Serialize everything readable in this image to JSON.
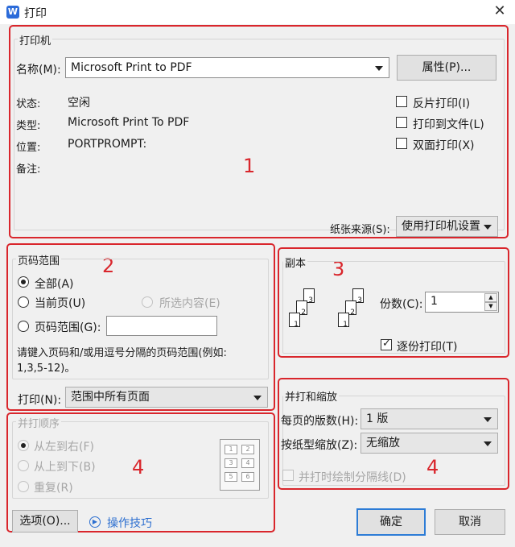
{
  "window": {
    "title": "打印",
    "app_icon": "W",
    "close": "✕"
  },
  "printer": {
    "group_title": "打印机",
    "name_label": "名称(M):",
    "name_value": "Microsoft Print to PDF",
    "properties_button": "属性(P)...",
    "status_label": "状态:",
    "status_value": "空闲",
    "type_label": "类型:",
    "type_value": "Microsoft Print To PDF",
    "location_label": "位置:",
    "location_value": "PORTPROMPT:",
    "comment_label": "备注:",
    "reverse_print": "反片打印(I)",
    "print_to_file": "打印到文件(L)",
    "duplex_print": "双面打印(X)",
    "paper_source_label": "纸张来源(S):",
    "paper_source_value": "使用打印机设置"
  },
  "page_range": {
    "group_title": "页码范围",
    "all": "全部(A)",
    "current_page": "当前页(U)",
    "selection": "所选内容(E)",
    "pages": "页码范围(G):",
    "pages_value": "",
    "hint_line1": "请键入页码和/或用逗号分隔的页码范围(例如:",
    "hint_line2": "1,3,5-12)。",
    "print_label": "打印(N):",
    "print_value": "范围中所有页面"
  },
  "copies": {
    "group_title": "副本",
    "count_label": "份数(C):",
    "count_value": "1",
    "collate": "逐份打印(T)",
    "stack_a": [
      "3",
      "2",
      "1"
    ],
    "stack_b": [
      "3",
      "2",
      "1"
    ]
  },
  "order": {
    "group_title": "并打顺序",
    "left_to_right": "从左到右(F)",
    "top_to_bottom": "从上到下(B)",
    "repeat": "重复(R)",
    "preview_cells": [
      "1",
      "2",
      "3",
      "4",
      "5",
      "6"
    ]
  },
  "zoom": {
    "group_title": "并打和缩放",
    "pages_per_sheet_label": "每页的版数(H):",
    "pages_per_sheet_value": "1 版",
    "scale_label": "按纸型缩放(Z):",
    "scale_value": "无缩放",
    "draw_separator": "并打时绘制分隔线(D)"
  },
  "footer": {
    "options_button": "选项(O)...",
    "tips_link": "操作技巧",
    "ok_button": "确定",
    "cancel_button": "取消"
  },
  "annotations": [
    "1",
    "2",
    "3",
    "4",
    "4"
  ],
  "colors": {
    "annotation": "#d9262c",
    "link": "#2d6fd0",
    "primary_border": "#2d7cd6"
  }
}
